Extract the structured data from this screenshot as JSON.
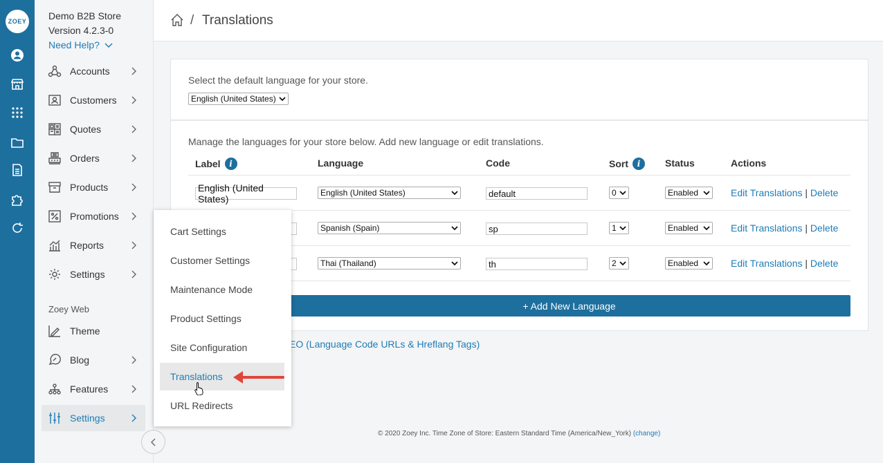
{
  "rail": {
    "logo": "ZOEY",
    "icons": [
      "user-circle-icon",
      "storefront-icon",
      "apps-grid-icon",
      "folder-icon",
      "document-icon",
      "puzzle-icon",
      "refresh-icon"
    ]
  },
  "sidebar": {
    "store_name": "Demo B2B Store",
    "version": "Version 4.2.3-0",
    "need_help": "Need Help?",
    "items": [
      {
        "label": "Accounts",
        "icon": "accounts-icon"
      },
      {
        "label": "Customers",
        "icon": "customers-icon"
      },
      {
        "label": "Quotes",
        "icon": "quotes-icon"
      },
      {
        "label": "Orders",
        "icon": "orders-icon"
      },
      {
        "label": "Products",
        "icon": "products-icon"
      },
      {
        "label": "Promotions",
        "icon": "promotions-icon"
      },
      {
        "label": "Reports",
        "icon": "reports-icon"
      },
      {
        "label": "Settings",
        "icon": "gear-icon"
      }
    ],
    "section_label": "Zoey Web",
    "web_items": [
      {
        "label": "Theme",
        "icon": "theme-icon"
      },
      {
        "label": "Blog",
        "icon": "blog-icon"
      },
      {
        "label": "Features",
        "icon": "features-icon"
      },
      {
        "label": "Settings",
        "icon": "sliders-icon",
        "active": true
      }
    ]
  },
  "header": {
    "separator": "/",
    "title": "Translations"
  },
  "default_language": {
    "prompt": "Select the default language for your store.",
    "selected": "English (United States)"
  },
  "languages": {
    "intro": "Manage the languages for your store below. Add new language or edit translations.",
    "columns": {
      "label": "Label",
      "language": "Language",
      "code": "Code",
      "sort": "Sort",
      "status": "Status",
      "actions": "Actions"
    },
    "rows": [
      {
        "label": "English (United States)",
        "language": "English (United States)",
        "code": "default",
        "sort": "0",
        "status": "Enabled"
      },
      {
        "label": "",
        "language": "Spanish (Spain)",
        "code": "sp",
        "sort": "1",
        "status": "Enabled"
      },
      {
        "label": "",
        "language": "Thai (Thailand)",
        "code": "th",
        "sort": "2",
        "status": "Enabled"
      }
    ],
    "edit_label": "Edit Translations",
    "action_sep": "|",
    "delete_label": "Delete",
    "add_button": "+ Add New Language",
    "seo_link": "EO (Language Code URLs & Hreflang Tags)"
  },
  "footer": {
    "text": "© 2020 Zoey Inc. Time Zone of Store: Eastern Standard Time (America/New_York)",
    "change_link": "(change)"
  },
  "flyout": {
    "items": [
      {
        "label": "Cart Settings"
      },
      {
        "label": "Customer Settings"
      },
      {
        "label": "Maintenance Mode"
      },
      {
        "label": "Product Settings"
      },
      {
        "label": "Site Configuration"
      },
      {
        "label": "Translations",
        "active": true
      },
      {
        "label": "URL Redirects"
      }
    ]
  },
  "colors": {
    "brand_blue": "#1d6f9e",
    "link_blue": "#1d7cb7",
    "annotation_arrow": "#e0453a"
  }
}
